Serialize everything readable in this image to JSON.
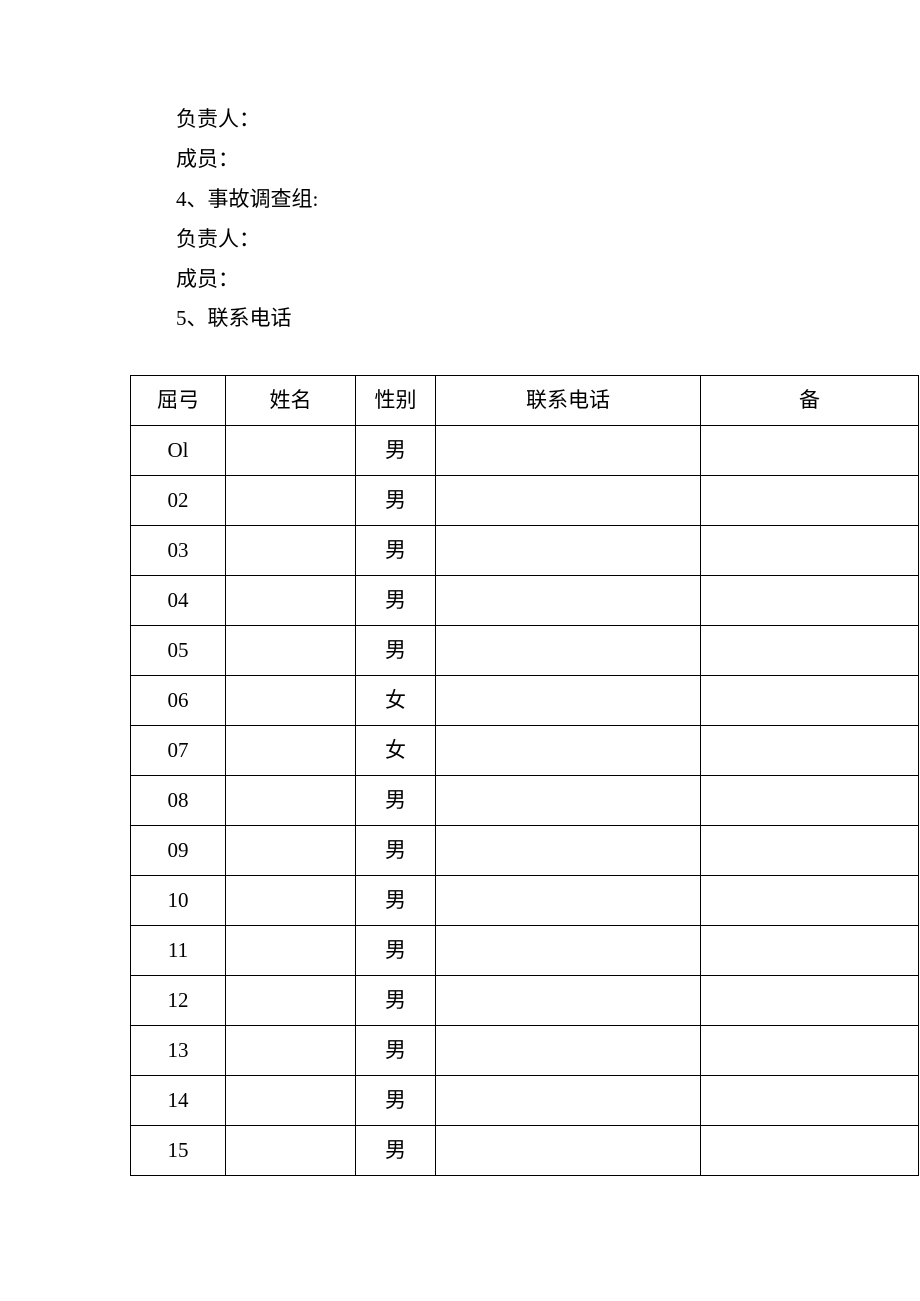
{
  "text_lines": [
    "负责人：",
    "成员：",
    "4、事故调查组:",
    "负责人：",
    "成员：",
    "5、联系电话"
  ],
  "table": {
    "headers": [
      "屈弓",
      "姓名",
      "性别",
      "联系电话",
      "备"
    ],
    "rows": [
      {
        "idx": "Ol",
        "name": "",
        "sex": "男",
        "phone": "",
        "note": ""
      },
      {
        "idx": "02",
        "name": "",
        "sex": "男",
        "phone": "",
        "note": ""
      },
      {
        "idx": "03",
        "name": "",
        "sex": "男",
        "phone": "",
        "note": ""
      },
      {
        "idx": "04",
        "name": "",
        "sex": "男",
        "phone": "",
        "note": ""
      },
      {
        "idx": "05",
        "name": "",
        "sex": "男",
        "phone": "",
        "note": ""
      },
      {
        "idx": "06",
        "name": "",
        "sex": "女",
        "phone": "",
        "note": ""
      },
      {
        "idx": "07",
        "name": "",
        "sex": "女",
        "phone": "",
        "note": ""
      },
      {
        "idx": "08",
        "name": "",
        "sex": "男",
        "phone": "",
        "note": ""
      },
      {
        "idx": "09",
        "name": "",
        "sex": "男",
        "phone": "",
        "note": ""
      },
      {
        "idx": "10",
        "name": "",
        "sex": "男",
        "phone": "",
        "note": ""
      },
      {
        "idx": "11",
        "name": "",
        "sex": "男",
        "phone": "",
        "note": ""
      },
      {
        "idx": "12",
        "name": "",
        "sex": "男",
        "phone": "",
        "note": ""
      },
      {
        "idx": "13",
        "name": "",
        "sex": "男",
        "phone": "",
        "note": ""
      },
      {
        "idx": "14",
        "name": "",
        "sex": "男",
        "phone": "",
        "note": ""
      },
      {
        "idx": "15",
        "name": "",
        "sex": "男",
        "phone": "",
        "note": ""
      }
    ]
  }
}
